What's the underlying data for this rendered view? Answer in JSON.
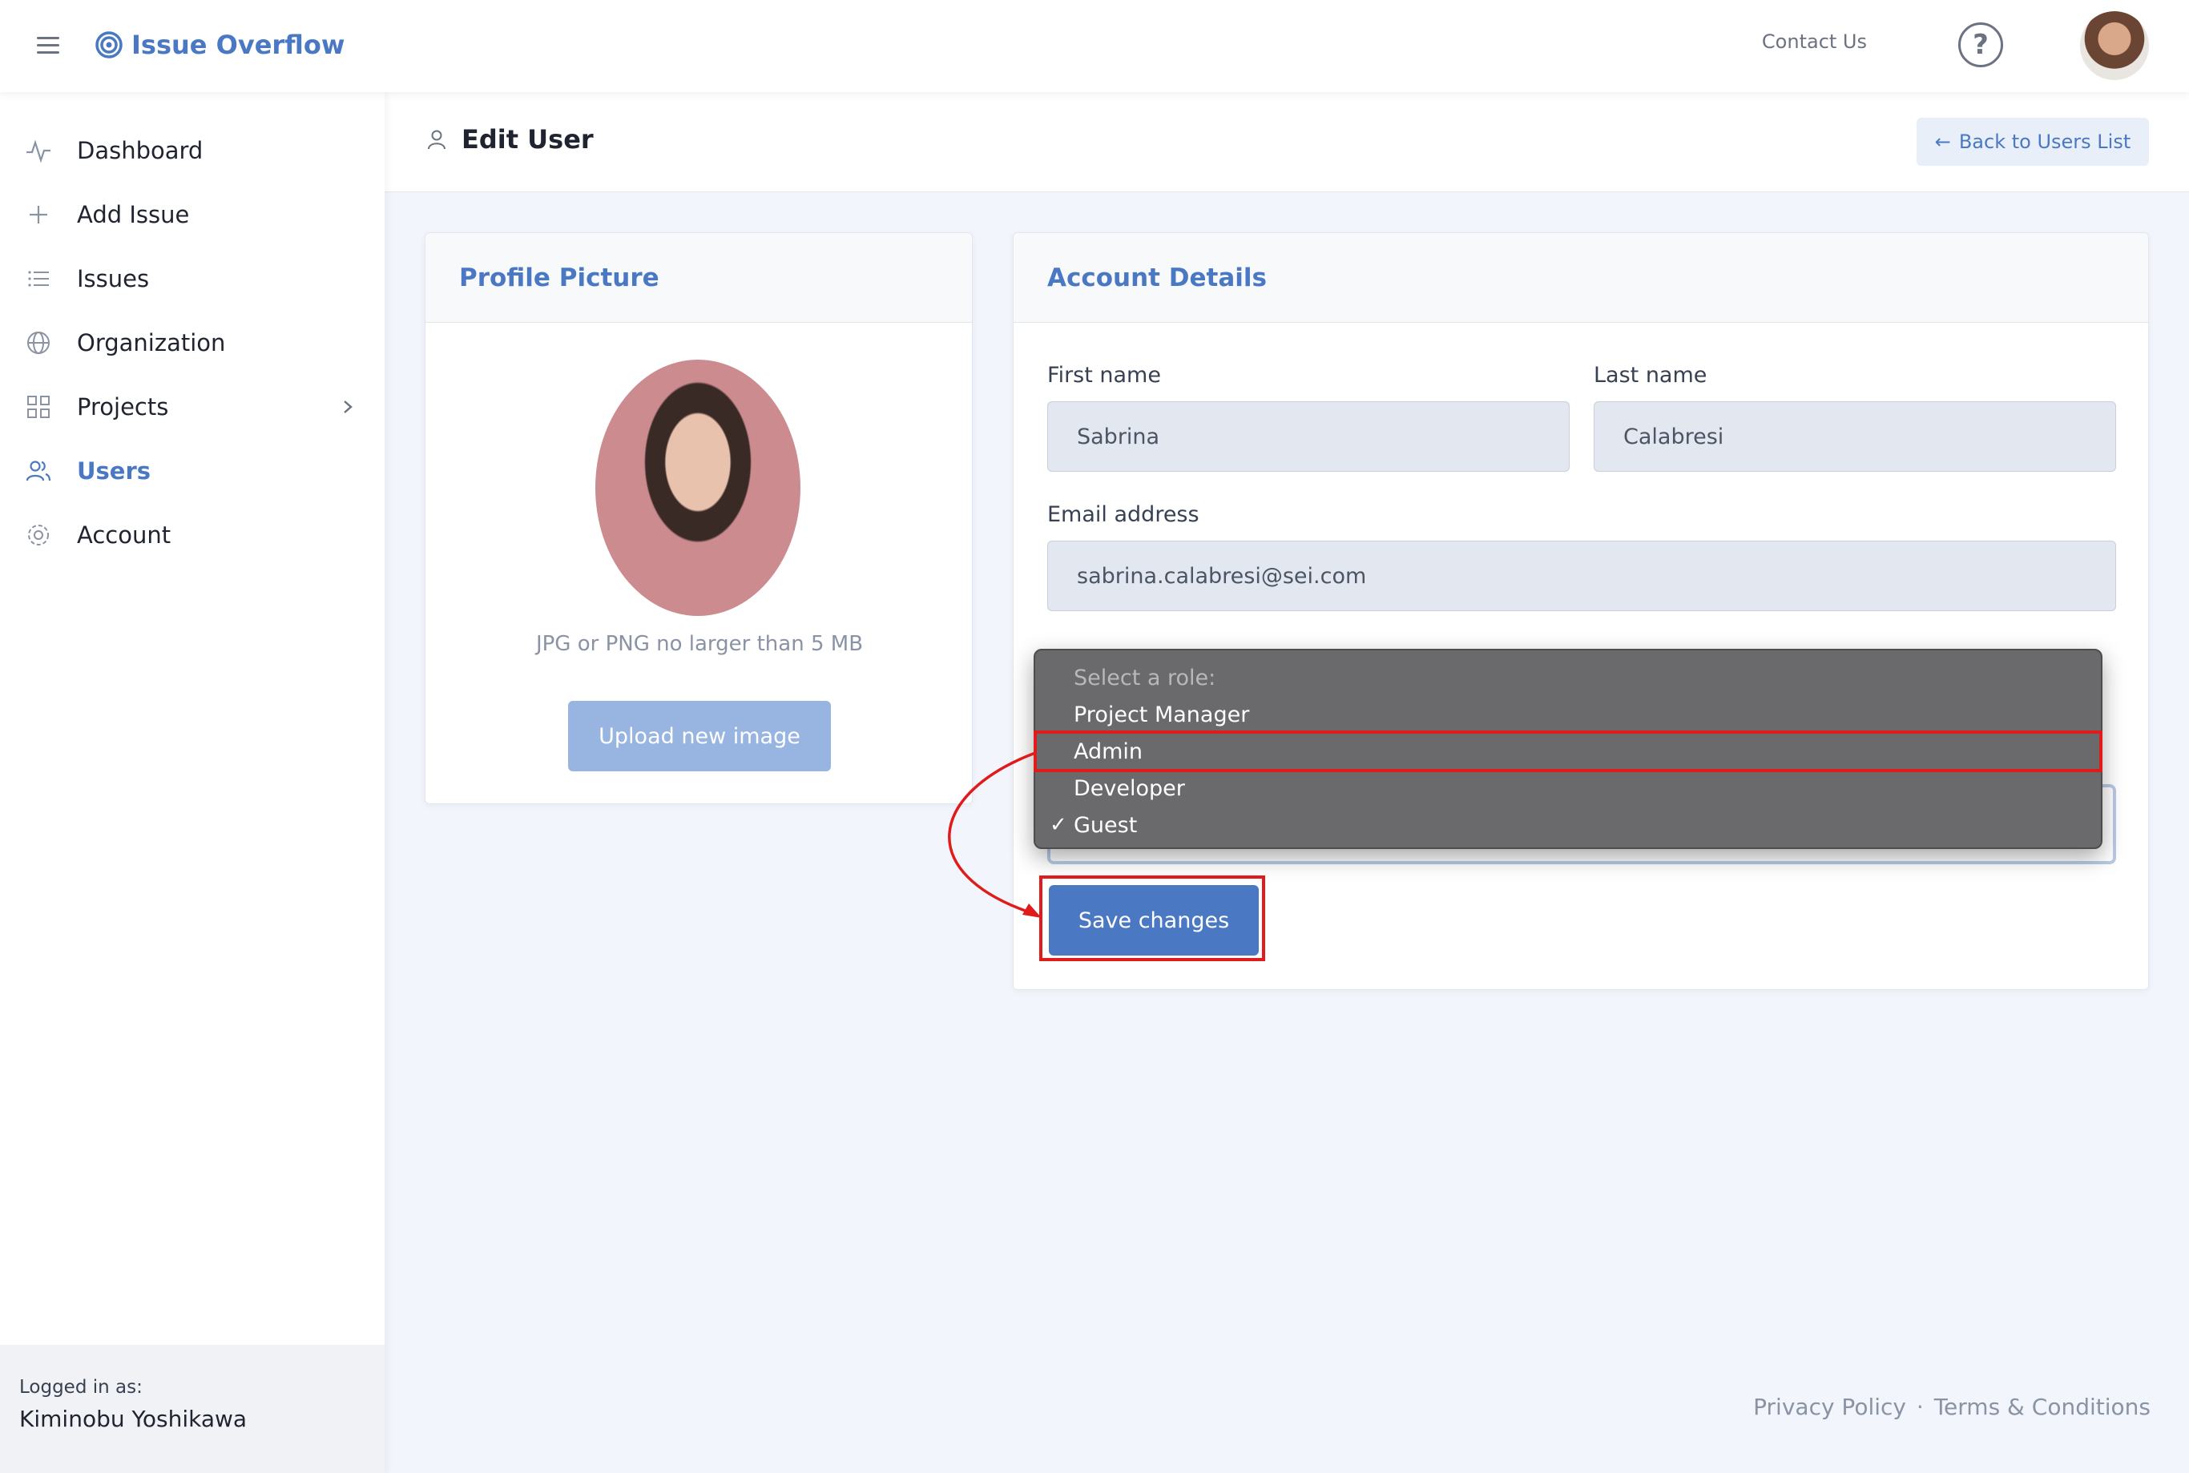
{
  "app": {
    "brand": "Issue Overflow",
    "contact": "Contact Us",
    "help_icon": "question-circle-icon"
  },
  "sidebar": {
    "items": [
      {
        "label": "Dashboard",
        "icon": "activity-icon"
      },
      {
        "label": "Add Issue",
        "icon": "plus-icon"
      },
      {
        "label": "Issues",
        "icon": "list-icon"
      },
      {
        "label": "Organization",
        "icon": "globe-icon"
      },
      {
        "label": "Projects",
        "icon": "grid-icon"
      },
      {
        "label": "Users",
        "icon": "users-icon",
        "active": true
      },
      {
        "label": "Account",
        "icon": "gear-icon"
      }
    ],
    "footer": {
      "logged_in_label": "Logged in as:",
      "user_name": "Kiminobu Yoshikawa"
    }
  },
  "page": {
    "title": "Edit User",
    "back_button": "Back to Users List"
  },
  "profile_card": {
    "title": "Profile Picture",
    "hint": "JPG or PNG no larger than 5 MB",
    "upload_button": "Upload new image"
  },
  "account_card": {
    "title": "Account Details",
    "first_name_label": "First name",
    "first_name_value": "Sabrina",
    "last_name_label": "Last name",
    "last_name_value": "Calabresi",
    "email_label": "Email address",
    "email_value": "sabrina.calabresi@sei.com",
    "save_button": "Save changes"
  },
  "role_dropdown": {
    "placeholder": "Select a role:",
    "options": [
      "Project Manager",
      "Admin",
      "Developer",
      "Guest"
    ],
    "selected": "Guest",
    "check_mark": "✓"
  },
  "footer": {
    "privacy": "Privacy Policy",
    "separator": "·",
    "terms": "Terms & Conditions"
  },
  "colors": {
    "accent": "#4a78c2",
    "annotation": "#e01b1b",
    "dropdown_bg": "#6a6a6c"
  }
}
